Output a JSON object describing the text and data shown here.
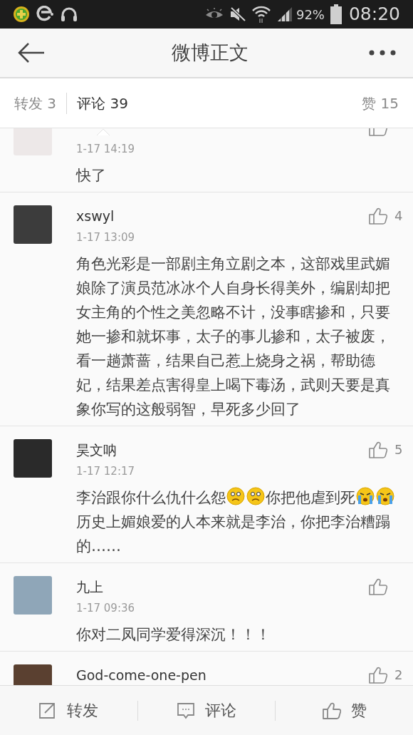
{
  "status_bar": {
    "battery": "92%",
    "time": "08:20"
  },
  "header": {
    "title": "微博正文"
  },
  "tabs": [
    {
      "label": "转发 3",
      "selected": false
    },
    {
      "label": "评论 39",
      "selected": true
    },
    {
      "label": "赞 15",
      "selected": false
    }
  ],
  "comments": [
    {
      "time": "1-17 14:19",
      "body": [
        {
          "kind": "text",
          "text": "快了"
        }
      ]
    },
    {
      "name": "xswyl",
      "time": "1-17 13:09",
      "likes": "4",
      "body": [
        {
          "kind": "text",
          "text": "角色光彩是一部剧主角立剧之本，这部戏里武媚娘除了演员范冰冰个人自身长得美外，编剧却把女主角的个性之美忽略不计，没事瞎掺和，只要她一掺和就坏事，太子的事儿掺和，太子被废，看一趟萧蔷，结果自己惹上烧身之祸，帮助德妃，结果差点害得皇上喝下毒汤，武则天要是真象你写的这般弱智，早死多少回了"
        }
      ]
    },
    {
      "name": "昊文呐",
      "time": "1-17 12:17",
      "likes": "5",
      "body": [
        {
          "kind": "text",
          "text": "李治跟你什么仇什么怨"
        },
        {
          "kind": "sad_emoji"
        },
        {
          "kind": "sad_emoji"
        },
        {
          "kind": "text",
          "text": "你把他虐到死"
        },
        {
          "kind": "crying_emoji"
        },
        {
          "kind": "crying_emoji"
        },
        {
          "kind": "text",
          "text": "历史上媚娘爱的人本来就是李治，你把李治糟蹋的……"
        }
      ]
    },
    {
      "name": "九上",
      "time": "1-17 09:36",
      "body": [
        {
          "kind": "text",
          "text": "你对二凤同学爱得深沉！！！"
        }
      ]
    },
    {
      "name": "God-come-one-pen",
      "likes": "2"
    }
  ],
  "bottom_bar": [
    {
      "kind": "share",
      "label": "转发"
    },
    {
      "kind": "comment",
      "label": "评论"
    },
    {
      "kind": "like",
      "label": "赞"
    }
  ]
}
